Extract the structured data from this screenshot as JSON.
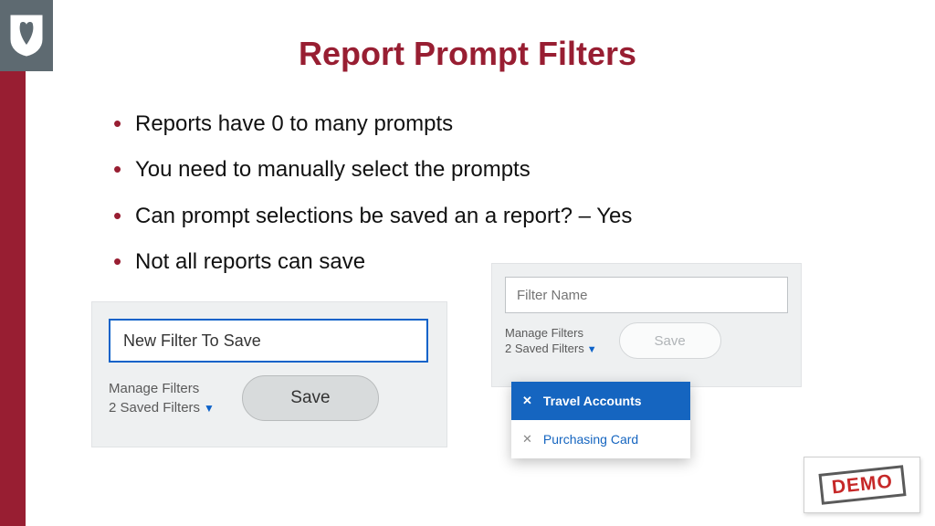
{
  "title": "Report Prompt Filters",
  "bullets": [
    "Reports have 0 to many prompts",
    "You need to manually select the prompts",
    "Can prompt selections be saved an a report? – Yes",
    "Not all reports can save"
  ],
  "panel1": {
    "input_value": "New Filter To Save",
    "manage_label": "Manage Filters",
    "saved_label": "2 Saved Filters",
    "save_label": "Save"
  },
  "panel2": {
    "input_placeholder": "Filter Name",
    "manage_label": "Manage Filters",
    "saved_label": "2 Saved Filters",
    "save_label": "Save"
  },
  "dropdown": {
    "items": [
      {
        "label": "Travel Accounts",
        "selected": true
      },
      {
        "label": "Purchasing Card",
        "selected": false
      }
    ]
  },
  "demo_label": "DEMO"
}
